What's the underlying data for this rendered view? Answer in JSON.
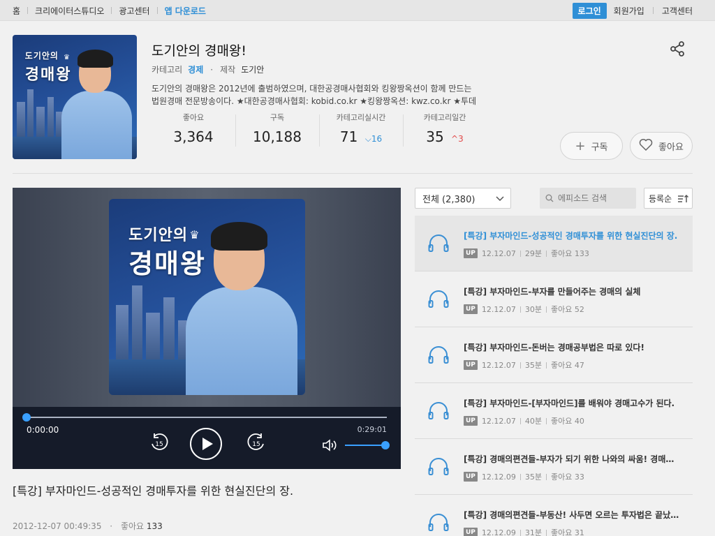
{
  "topbar": {
    "nav": [
      "홈",
      "크리에이터스튜디오",
      "광고센터",
      "앱 다운로드"
    ],
    "login": "로그인",
    "right": [
      "회원가입",
      "고객센터"
    ]
  },
  "channel": {
    "title": "도기안의 경매왕!",
    "category_label": "카테고리",
    "category": "경제",
    "maker_label": "제작",
    "maker": "도기안",
    "desc_line1": "도기안의 경매왕은 2012년에 출범하였으며, 대한공경매사협회와 킹왕짱옥션이 함께 만드는",
    "desc_line2": "법원경매 전문방송이다. ★대한공경매사협회: kobid.co.kr ★킹왕짱옥션: kwz.co.kr ★투데",
    "cover_text1": "도기안의",
    "cover_text2": "경매왕",
    "stats": {
      "likes_label": "좋아요",
      "likes": "3,364",
      "subs_label": "구독",
      "subs": "10,188",
      "rt_label": "카테고리실시간",
      "rt": "71",
      "rt_delta": "16",
      "daily_label": "카테고리일간",
      "daily": "35",
      "daily_delta": "3"
    },
    "subscribe_btn": "구독",
    "like_btn": "좋아요"
  },
  "player": {
    "current_time": "0:00:00",
    "duration": "0:29:01",
    "skip_seconds": "15",
    "progress": 0.0,
    "volume": 1.0
  },
  "episode": {
    "title": "[특강] 부자마인드-성공적인 경매투자를 위한 현실진단의 장.",
    "date": "2012-12-07 00:49:35",
    "likes_label": "좋아요",
    "likes": "133"
  },
  "list": {
    "filter": "전체 (2,380)",
    "search_placeholder": "에피소드 검색",
    "sort": "등록순",
    "up_badge": "UP",
    "items": [
      {
        "title": "[특강] 부자마인드-성공적인 경매투자를 위한 현실진단의 장.",
        "date": "12.12.07",
        "dur": "29분",
        "likes": "좋아요 133"
      },
      {
        "title": "[특강] 부자마인드-부자를 만들어주는 경매의 실체",
        "date": "12.12.07",
        "dur": "30분",
        "likes": "좋아요 52"
      },
      {
        "title": "[특강] 부자마인드-돈버는 경매공부법은 따로 있다!",
        "date": "12.12.07",
        "dur": "35분",
        "likes": "좋아요 47"
      },
      {
        "title": "[특강] 부자마인드-[부자마인드]를 배워야 경매고수가 된다.",
        "date": "12.12.07",
        "dur": "40분",
        "likes": "좋아요 40"
      },
      {
        "title": "[특강] 경매의편견들-부자가 되기 위한 나와의 싸움! 경매의…",
        "date": "12.12.09",
        "dur": "35분",
        "likes": "좋아요 33"
      },
      {
        "title": "[특강] 경매의편견들-부동산! 사두면 오르는 투자법은 끝났…",
        "date": "12.12.09",
        "dur": "31분",
        "likes": "좋아요 31"
      }
    ]
  },
  "colors": {
    "accent": "#2f8fd6",
    "up": "#e24b4b",
    "player_bg": "#151b29"
  }
}
